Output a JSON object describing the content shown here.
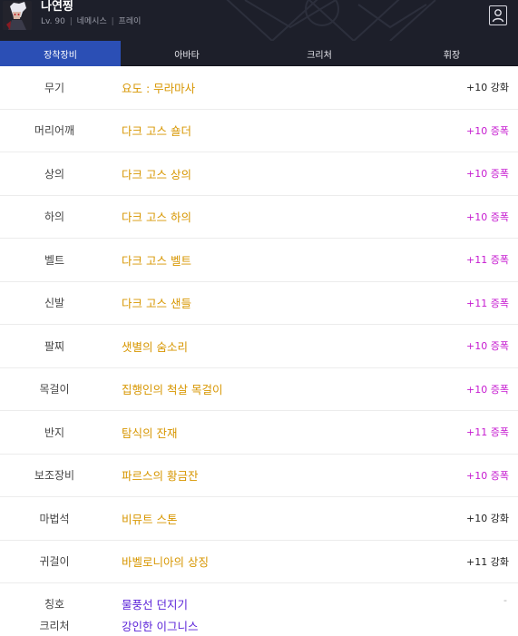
{
  "header": {
    "character_name": "나연찡",
    "level": "Lv. 90",
    "job": "네메시스",
    "guild": "프레이",
    "separator": "|"
  },
  "tabs": [
    {
      "label": "장착장비",
      "active": true
    },
    {
      "label": "아바타",
      "active": false
    },
    {
      "label": "크리처",
      "active": false
    },
    {
      "label": "휘장",
      "active": false
    }
  ],
  "equipment": [
    {
      "slot": "무기",
      "item": "요도 : 무라마사",
      "enhance": "+10 강화",
      "type": "reinforce"
    },
    {
      "slot": "머리어깨",
      "item": "다크 고스 숄더",
      "enhance": "+10 증폭",
      "type": "amplify"
    },
    {
      "slot": "상의",
      "item": "다크 고스 상의",
      "enhance": "+10 증폭",
      "type": "amplify"
    },
    {
      "slot": "하의",
      "item": "다크 고스 하의",
      "enhance": "+10 증폭",
      "type": "amplify"
    },
    {
      "slot": "벨트",
      "item": "다크 고스 벨트",
      "enhance": "+11 증폭",
      "type": "amplify"
    },
    {
      "slot": "신발",
      "item": "다크 고스 샌들",
      "enhance": "+11 증폭",
      "type": "amplify"
    },
    {
      "slot": "팔찌",
      "item": "샛별의 숨소리",
      "enhance": "+10 증폭",
      "type": "amplify"
    },
    {
      "slot": "목걸이",
      "item": "집행인의 척살 목걸이",
      "enhance": "+10 증폭",
      "type": "amplify"
    },
    {
      "slot": "반지",
      "item": "탐식의 잔재",
      "enhance": "+11 증폭",
      "type": "amplify"
    },
    {
      "slot": "보조장비",
      "item": "파르스의 황금잔",
      "enhance": "+10 증폭",
      "type": "amplify"
    },
    {
      "slot": "마법석",
      "item": "비뮤트 스톤",
      "enhance": "+10 강화",
      "type": "reinforce"
    },
    {
      "slot": "귀걸이",
      "item": "바벨로니아의 상징",
      "enhance": "+11 강화",
      "type": "reinforce"
    }
  ],
  "extras": {
    "title_slot": "칭호",
    "title_value": "물풍선 던지기",
    "creature_slot": "크리처",
    "creature_value": "강인한 이그니스",
    "dash": "-"
  },
  "colors": {
    "header_bg": "#1d1f2a",
    "active_tab": "#2b4fb5",
    "item_name": "#d79600",
    "amplify": "#c61bd0",
    "extra_value": "#5a22d8"
  },
  "icons": {
    "avatar": "character-portrait",
    "profile": "person-silhouette-icon"
  }
}
